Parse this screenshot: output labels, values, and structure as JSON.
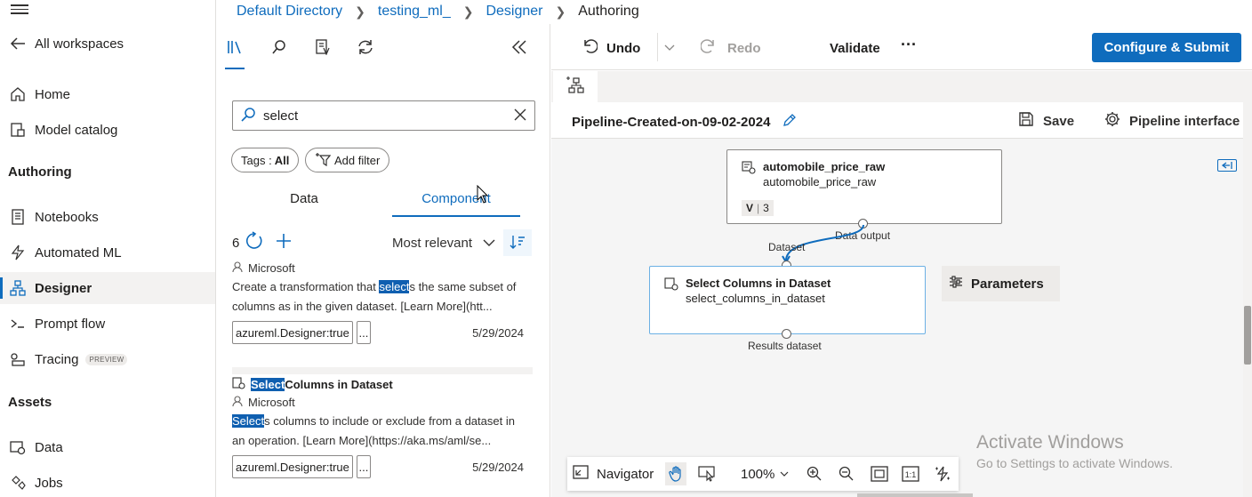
{
  "nav": {
    "all_workspaces": "All workspaces",
    "home": "Home",
    "model_catalog": "Model catalog",
    "section_authoring": "Authoring",
    "notebooks": "Notebooks",
    "automated_ml": "Automated ML",
    "designer": "Designer",
    "prompt_flow": "Prompt flow",
    "tracing": "Tracing",
    "tracing_badge": "PREVIEW",
    "section_assets": "Assets",
    "data": "Data",
    "jobs": "Jobs"
  },
  "breadcrumb": {
    "c1": "Default Directory",
    "c2": "testing_ml_",
    "c3": "Designer",
    "current": "Authoring"
  },
  "panel": {
    "search_value": "select",
    "tags_label": "Tags :",
    "tags_value": "All",
    "add_filter": "Add filter",
    "tab_data": "Data",
    "tab_component": "Component",
    "count": "6",
    "sort": "Most relevant",
    "cards": [
      {
        "publisher": "Microsoft",
        "desc_pre": "Create a transformation that ",
        "desc_hl": "select",
        "desc_post": "s the same subset of columns as in the given dataset. [Learn More](htt...",
        "tag": "azureml.Designer:true",
        "more": "...",
        "date": "5/29/2024"
      },
      {
        "title_hl": "Select",
        "title_rest": " Columns in Dataset",
        "publisher": "Microsoft",
        "desc_hl": "Select",
        "desc_post": "s columns to include or exclude from a dataset in an operation. [Learn More](https://aka.ms/aml/se...",
        "tag": "azureml.Designer:true",
        "more": "...",
        "date": "5/29/2024"
      }
    ]
  },
  "toolbar": {
    "undo": "Undo",
    "redo": "Redo",
    "validate": "Validate",
    "more": "···",
    "submit": "Configure & Submit"
  },
  "pipeline": {
    "title": "Pipeline-Created-on-09-02-2024",
    "save": "Save",
    "interface": "Pipeline interface"
  },
  "nodes": {
    "n1_title": "automobile_price_raw",
    "n1_sub": "automobile_price_raw",
    "n1_ver_v": "V",
    "n1_ver_num": "3",
    "n1_output": "Data output",
    "n2_input": "Dataset",
    "n2_title": "Select Columns in Dataset",
    "n2_sub": "select_columns_in_dataset",
    "n2_output": "Results dataset",
    "parameters": "Parameters"
  },
  "navigator": {
    "label": "Navigator",
    "zoom": "100%"
  },
  "watermark": {
    "line1": "Activate Windows",
    "line2": "Go to Settings to activate Windows."
  }
}
